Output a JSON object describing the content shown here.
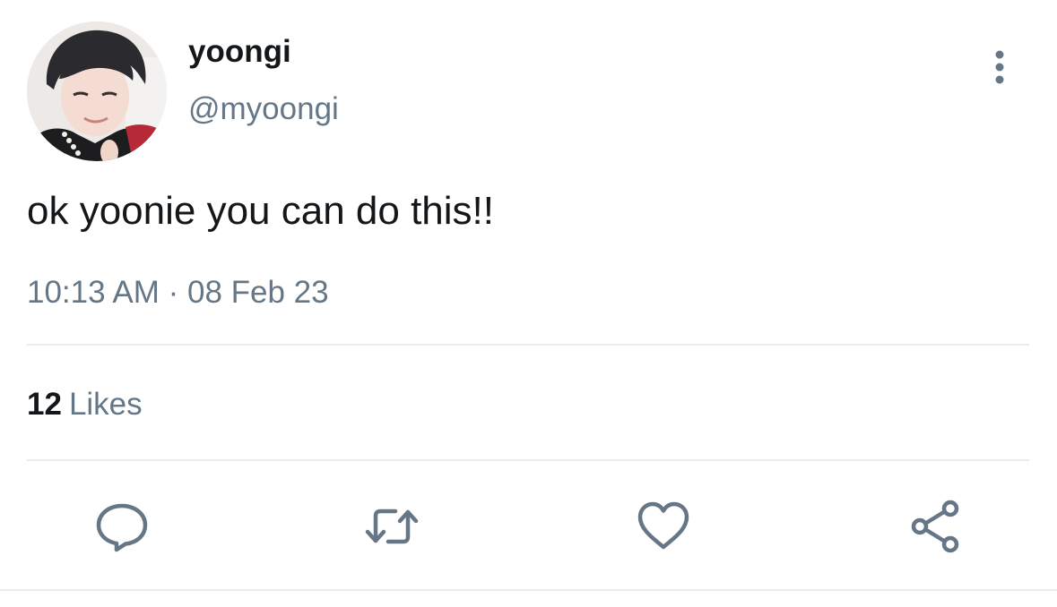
{
  "tweet": {
    "author": {
      "display_name": "yoongi",
      "handle": "@myoongi",
      "avatar_icon": "profile-photo"
    },
    "text": "ok yoonie you can do this!!",
    "timestamp": "10:13 AM · 08 Feb 23",
    "stats": {
      "likes_count": "12",
      "likes_label": "Likes"
    },
    "actions": {
      "reply_icon": "reply-icon",
      "retweet_icon": "retweet-icon",
      "like_icon": "heart-icon",
      "share_icon": "share-icon",
      "more_icon": "more-vertical-icon"
    }
  },
  "colors": {
    "primary_text": "#14171a",
    "secondary_text": "#657786",
    "icon": "#657786",
    "divider": "#e6ecf0",
    "background": "#ffffff"
  }
}
